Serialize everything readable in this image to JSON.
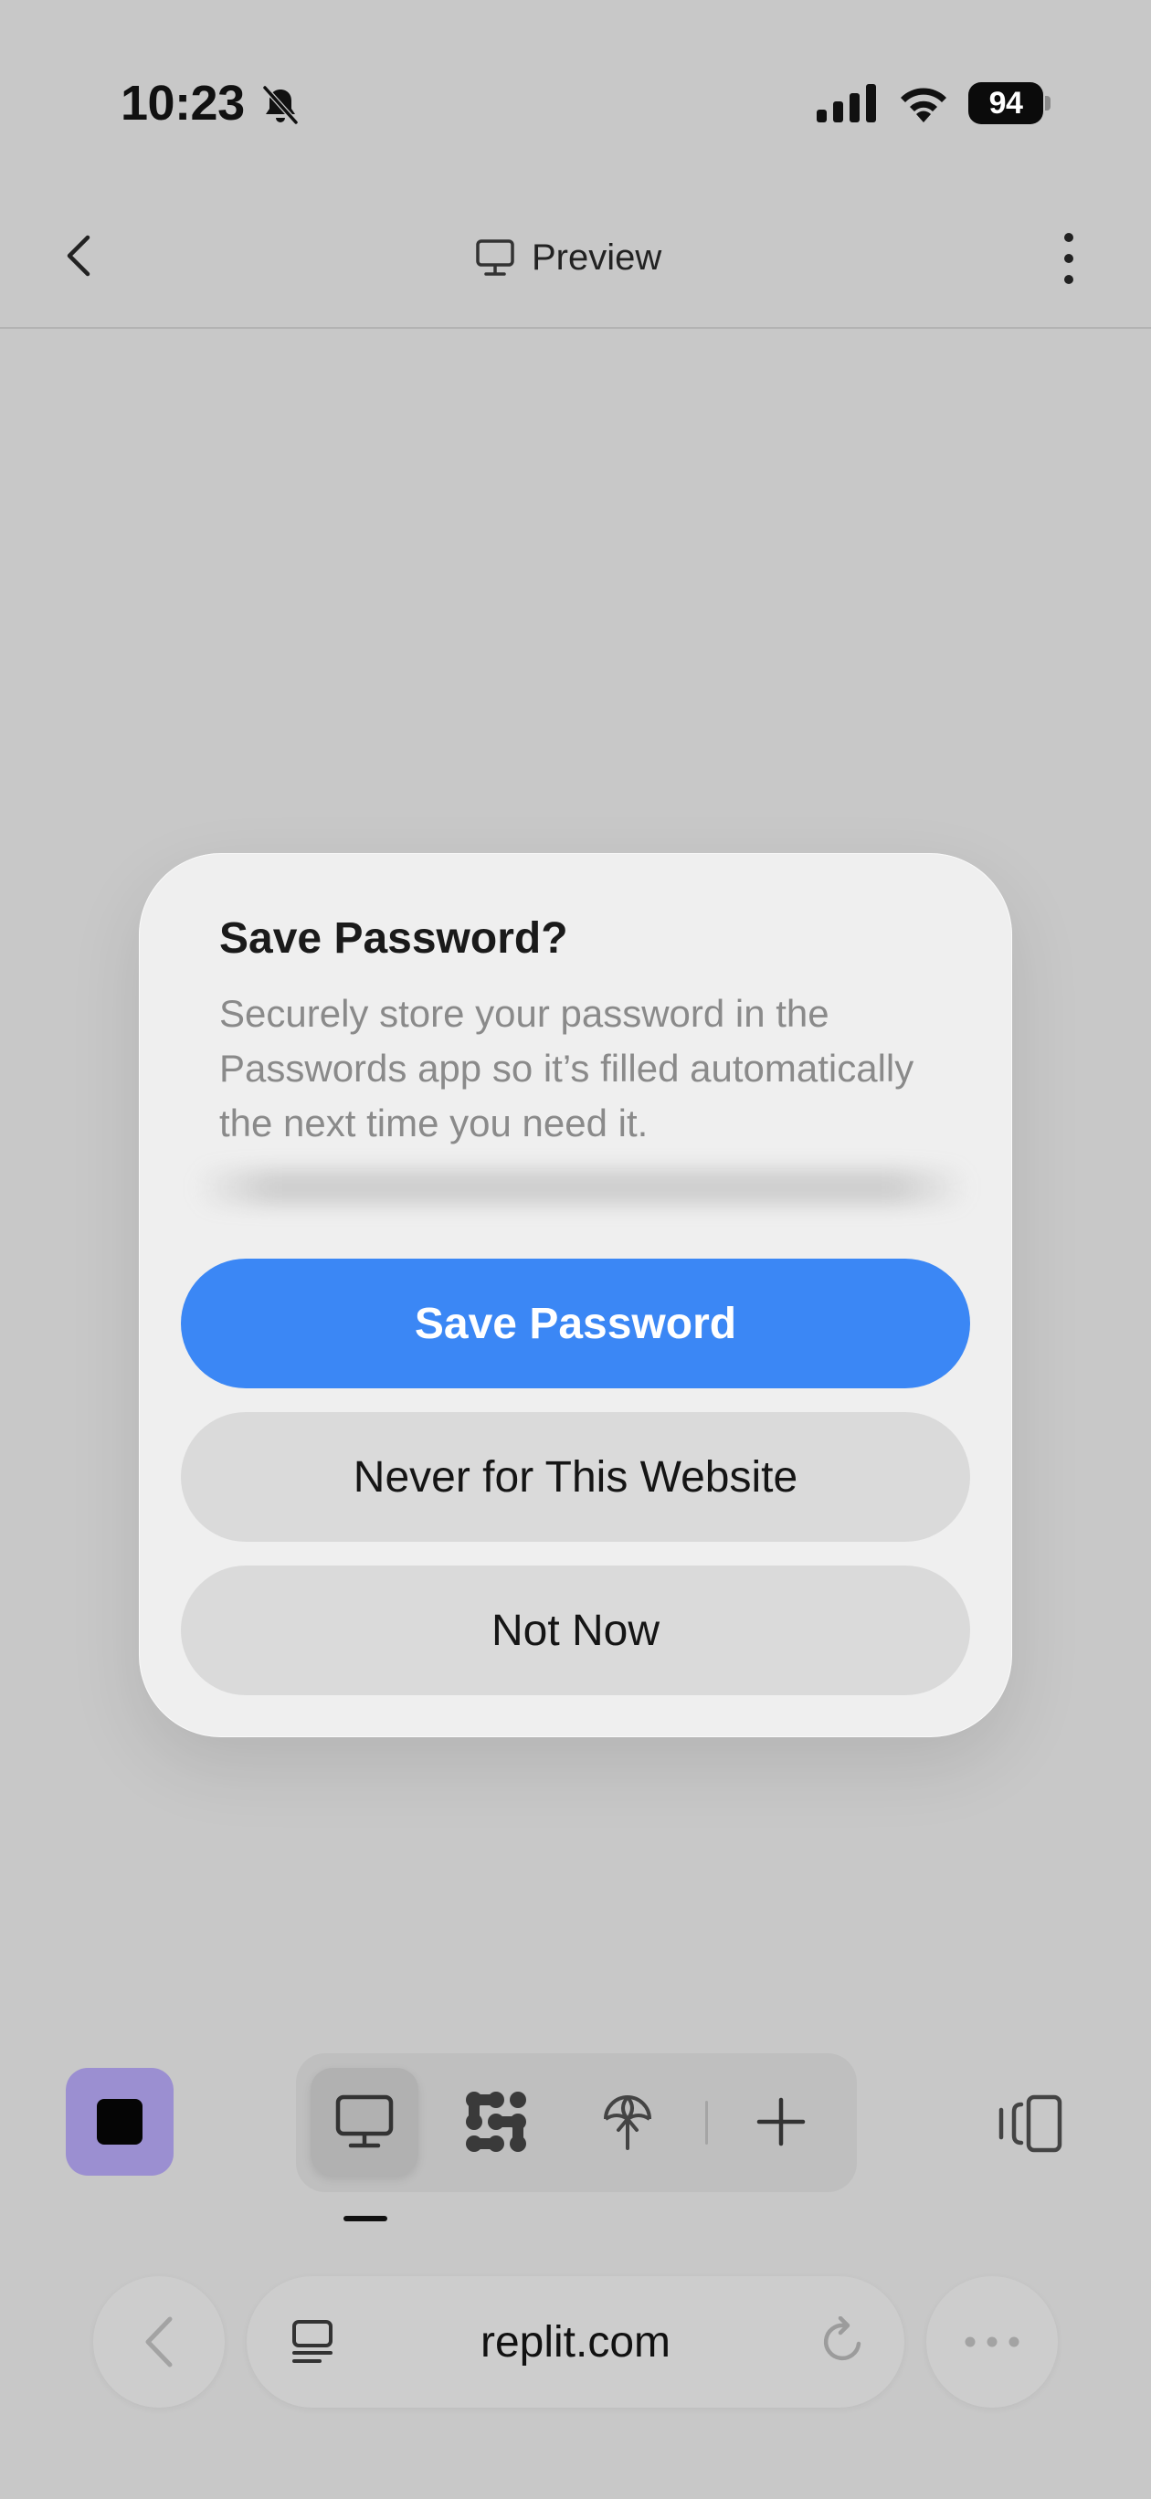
{
  "status_bar": {
    "time": "10:23",
    "battery": "94",
    "icons": [
      "bell-slash-icon",
      "cellular-signal-icon",
      "wifi-icon",
      "battery-icon"
    ]
  },
  "header": {
    "title": "Preview",
    "icons": [
      "chevron-left-icon",
      "monitor-icon",
      "vertical-ellipsis-icon"
    ]
  },
  "dialog": {
    "title": "Save Password?",
    "body": "Securely store your password in the Passwords app so it’s filled automatically the next time you need it.",
    "primary_button": "Save Password",
    "secondary_button": "Never for This Website",
    "tertiary_button": "Not Now"
  },
  "toolbar": {
    "tools": [
      "stop-icon",
      "monitor-icon",
      "agent-icon",
      "deploy-icon",
      "plus-icon",
      "panel-toggle-icon"
    ],
    "active_tool": "monitor-icon"
  },
  "browser_bar": {
    "url": "replit.com",
    "icons": [
      "chevron-left-icon",
      "reader-icon",
      "reload-icon",
      "ellipsis-icon"
    ]
  },
  "colors": {
    "background": "#c8c8c8",
    "dialog": "#efefef",
    "primary": "#3b87f5",
    "secondary_button": "#dadada",
    "stop_button": "#9b8fd1"
  }
}
